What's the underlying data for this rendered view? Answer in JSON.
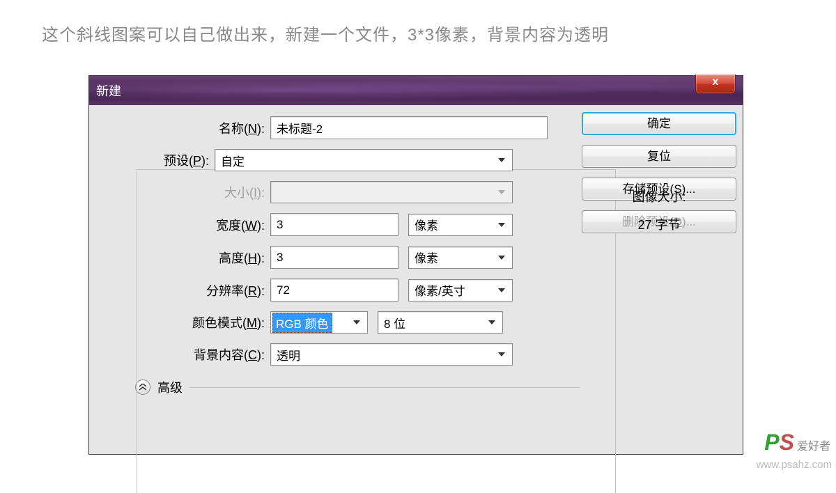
{
  "caption": "这个斜线图案可以自己做出来，新建一个文件，3*3像素，背景内容为透明",
  "dialog": {
    "title": "新建",
    "close_x": "x",
    "labels": {
      "name": "名称(N):",
      "preset": "预设(P):",
      "size": "大小(I):",
      "width": "宽度(W):",
      "height": "高度(H):",
      "resolution": "分辨率(R):",
      "color_mode": "颜色模式(M):",
      "background": "背景内容(C):",
      "advanced": "高级"
    },
    "values": {
      "name": "未标题-2",
      "preset": "自定",
      "size": "",
      "width": "3",
      "width_unit": "像素",
      "height": "3",
      "height_unit": "像素",
      "resolution": "72",
      "resolution_unit": "像素/英寸",
      "color_mode": "RGB 颜色",
      "color_depth": "8 位",
      "background": "透明"
    },
    "buttons": {
      "ok": "确定",
      "reset": "复位",
      "save_preset": "存储预设(S)...",
      "delete_preset": "删除预设(D)..."
    },
    "image_size": {
      "label": "图像大小:",
      "value": "27 字节"
    }
  },
  "watermark": {
    "url": "www.psahz.com",
    "brand": "爱好者"
  }
}
